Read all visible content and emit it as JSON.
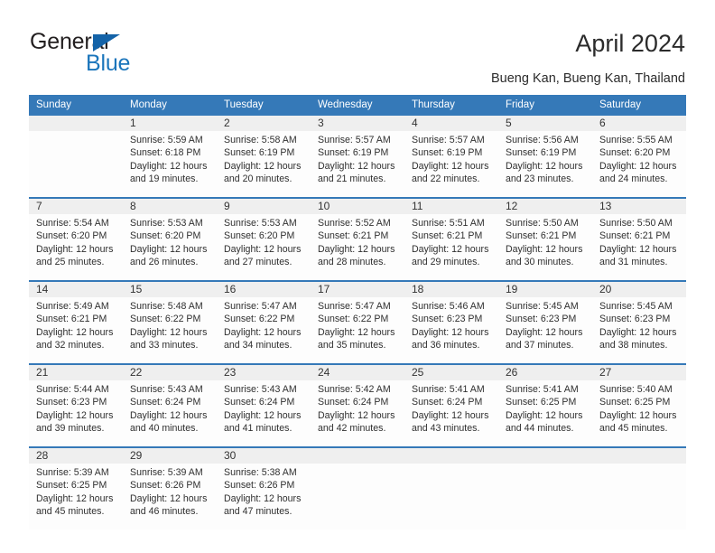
{
  "brand": {
    "name_part1": "General",
    "name_part2": "Blue",
    "accent_color": "#1b75bb",
    "flag_color": "#1463a8"
  },
  "header": {
    "title": "April 2024",
    "subtitle": "Bueng Kan, Bueng Kan, Thailand"
  },
  "calendar": {
    "header_bg": "#3579b8",
    "daynum_bg": "#efefef",
    "weekday_headers": [
      "Sunday",
      "Monday",
      "Tuesday",
      "Wednesday",
      "Thursday",
      "Friday",
      "Saturday"
    ],
    "weeks": [
      [
        {
          "day": "",
          "empty": true,
          "sunrise": "",
          "sunset": "",
          "daylight_line1": "",
          "daylight_line2": ""
        },
        {
          "day": "1",
          "sunrise": "Sunrise: 5:59 AM",
          "sunset": "Sunset: 6:18 PM",
          "daylight_line1": "Daylight: 12 hours",
          "daylight_line2": "and 19 minutes."
        },
        {
          "day": "2",
          "sunrise": "Sunrise: 5:58 AM",
          "sunset": "Sunset: 6:19 PM",
          "daylight_line1": "Daylight: 12 hours",
          "daylight_line2": "and 20 minutes."
        },
        {
          "day": "3",
          "sunrise": "Sunrise: 5:57 AM",
          "sunset": "Sunset: 6:19 PM",
          "daylight_line1": "Daylight: 12 hours",
          "daylight_line2": "and 21 minutes."
        },
        {
          "day": "4",
          "sunrise": "Sunrise: 5:57 AM",
          "sunset": "Sunset: 6:19 PM",
          "daylight_line1": "Daylight: 12 hours",
          "daylight_line2": "and 22 minutes."
        },
        {
          "day": "5",
          "sunrise": "Sunrise: 5:56 AM",
          "sunset": "Sunset: 6:19 PM",
          "daylight_line1": "Daylight: 12 hours",
          "daylight_line2": "and 23 minutes."
        },
        {
          "day": "6",
          "sunrise": "Sunrise: 5:55 AM",
          "sunset": "Sunset: 6:20 PM",
          "daylight_line1": "Daylight: 12 hours",
          "daylight_line2": "and 24 minutes."
        }
      ],
      [
        {
          "day": "7",
          "sunrise": "Sunrise: 5:54 AM",
          "sunset": "Sunset: 6:20 PM",
          "daylight_line1": "Daylight: 12 hours",
          "daylight_line2": "and 25 minutes."
        },
        {
          "day": "8",
          "sunrise": "Sunrise: 5:53 AM",
          "sunset": "Sunset: 6:20 PM",
          "daylight_line1": "Daylight: 12 hours",
          "daylight_line2": "and 26 minutes."
        },
        {
          "day": "9",
          "sunrise": "Sunrise: 5:53 AM",
          "sunset": "Sunset: 6:20 PM",
          "daylight_line1": "Daylight: 12 hours",
          "daylight_line2": "and 27 minutes."
        },
        {
          "day": "10",
          "sunrise": "Sunrise: 5:52 AM",
          "sunset": "Sunset: 6:21 PM",
          "daylight_line1": "Daylight: 12 hours",
          "daylight_line2": "and 28 minutes."
        },
        {
          "day": "11",
          "sunrise": "Sunrise: 5:51 AM",
          "sunset": "Sunset: 6:21 PM",
          "daylight_line1": "Daylight: 12 hours",
          "daylight_line2": "and 29 minutes."
        },
        {
          "day": "12",
          "sunrise": "Sunrise: 5:50 AM",
          "sunset": "Sunset: 6:21 PM",
          "daylight_line1": "Daylight: 12 hours",
          "daylight_line2": "and 30 minutes."
        },
        {
          "day": "13",
          "sunrise": "Sunrise: 5:50 AM",
          "sunset": "Sunset: 6:21 PM",
          "daylight_line1": "Daylight: 12 hours",
          "daylight_line2": "and 31 minutes."
        }
      ],
      [
        {
          "day": "14",
          "sunrise": "Sunrise: 5:49 AM",
          "sunset": "Sunset: 6:21 PM",
          "daylight_line1": "Daylight: 12 hours",
          "daylight_line2": "and 32 minutes."
        },
        {
          "day": "15",
          "sunrise": "Sunrise: 5:48 AM",
          "sunset": "Sunset: 6:22 PM",
          "daylight_line1": "Daylight: 12 hours",
          "daylight_line2": "and 33 minutes."
        },
        {
          "day": "16",
          "sunrise": "Sunrise: 5:47 AM",
          "sunset": "Sunset: 6:22 PM",
          "daylight_line1": "Daylight: 12 hours",
          "daylight_line2": "and 34 minutes."
        },
        {
          "day": "17",
          "sunrise": "Sunrise: 5:47 AM",
          "sunset": "Sunset: 6:22 PM",
          "daylight_line1": "Daylight: 12 hours",
          "daylight_line2": "and 35 minutes."
        },
        {
          "day": "18",
          "sunrise": "Sunrise: 5:46 AM",
          "sunset": "Sunset: 6:23 PM",
          "daylight_line1": "Daylight: 12 hours",
          "daylight_line2": "and 36 minutes."
        },
        {
          "day": "19",
          "sunrise": "Sunrise: 5:45 AM",
          "sunset": "Sunset: 6:23 PM",
          "daylight_line1": "Daylight: 12 hours",
          "daylight_line2": "and 37 minutes."
        },
        {
          "day": "20",
          "sunrise": "Sunrise: 5:45 AM",
          "sunset": "Sunset: 6:23 PM",
          "daylight_line1": "Daylight: 12 hours",
          "daylight_line2": "and 38 minutes."
        }
      ],
      [
        {
          "day": "21",
          "sunrise": "Sunrise: 5:44 AM",
          "sunset": "Sunset: 6:23 PM",
          "daylight_line1": "Daylight: 12 hours",
          "daylight_line2": "and 39 minutes."
        },
        {
          "day": "22",
          "sunrise": "Sunrise: 5:43 AM",
          "sunset": "Sunset: 6:24 PM",
          "daylight_line1": "Daylight: 12 hours",
          "daylight_line2": "and 40 minutes."
        },
        {
          "day": "23",
          "sunrise": "Sunrise: 5:43 AM",
          "sunset": "Sunset: 6:24 PM",
          "daylight_line1": "Daylight: 12 hours",
          "daylight_line2": "and 41 minutes."
        },
        {
          "day": "24",
          "sunrise": "Sunrise: 5:42 AM",
          "sunset": "Sunset: 6:24 PM",
          "daylight_line1": "Daylight: 12 hours",
          "daylight_line2": "and 42 minutes."
        },
        {
          "day": "25",
          "sunrise": "Sunrise: 5:41 AM",
          "sunset": "Sunset: 6:24 PM",
          "daylight_line1": "Daylight: 12 hours",
          "daylight_line2": "and 43 minutes."
        },
        {
          "day": "26",
          "sunrise": "Sunrise: 5:41 AM",
          "sunset": "Sunset: 6:25 PM",
          "daylight_line1": "Daylight: 12 hours",
          "daylight_line2": "and 44 minutes."
        },
        {
          "day": "27",
          "sunrise": "Sunrise: 5:40 AM",
          "sunset": "Sunset: 6:25 PM",
          "daylight_line1": "Daylight: 12 hours",
          "daylight_line2": "and 45 minutes."
        }
      ],
      [
        {
          "day": "28",
          "sunrise": "Sunrise: 5:39 AM",
          "sunset": "Sunset: 6:25 PM",
          "daylight_line1": "Daylight: 12 hours",
          "daylight_line2": "and 45 minutes."
        },
        {
          "day": "29",
          "sunrise": "Sunrise: 5:39 AM",
          "sunset": "Sunset: 6:26 PM",
          "daylight_line1": "Daylight: 12 hours",
          "daylight_line2": "and 46 minutes."
        },
        {
          "day": "30",
          "sunrise": "Sunrise: 5:38 AM",
          "sunset": "Sunset: 6:26 PM",
          "daylight_line1": "Daylight: 12 hours",
          "daylight_line2": "and 47 minutes."
        },
        {
          "day": "",
          "empty": true,
          "sunrise": "",
          "sunset": "",
          "daylight_line1": "",
          "daylight_line2": ""
        },
        {
          "day": "",
          "empty": true,
          "sunrise": "",
          "sunset": "",
          "daylight_line1": "",
          "daylight_line2": ""
        },
        {
          "day": "",
          "empty": true,
          "sunrise": "",
          "sunset": "",
          "daylight_line1": "",
          "daylight_line2": ""
        },
        {
          "day": "",
          "empty": true,
          "sunrise": "",
          "sunset": "",
          "daylight_line1": "",
          "daylight_line2": ""
        }
      ]
    ]
  }
}
